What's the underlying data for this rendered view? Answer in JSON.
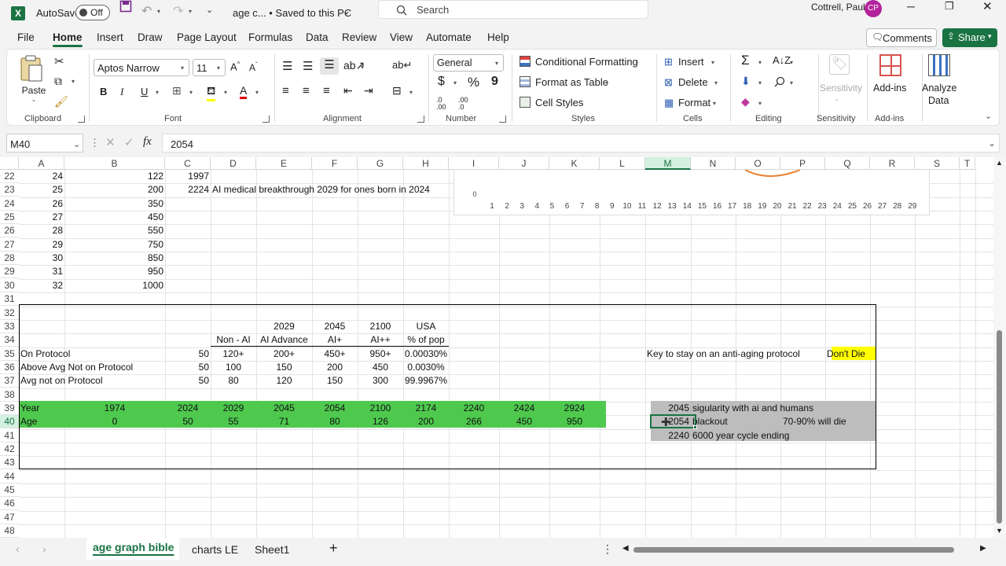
{
  "titlebar": {
    "autosave_label": "AutoSave",
    "autosave_state": "Off",
    "doc_title": "age c... • Saved to this PC",
    "search_placeholder": "Search",
    "user_name": "Cottrell, Paul",
    "user_initials": "CP"
  },
  "menu": {
    "items": [
      "File",
      "Home",
      "Insert",
      "Draw",
      "Page Layout",
      "Formulas",
      "Data",
      "Review",
      "View",
      "Automate",
      "Help"
    ],
    "active": "Home",
    "comments_label": "Comments",
    "share_label": "Share"
  },
  "ribbon": {
    "clipboard": {
      "paste": "Paste",
      "label": "Clipboard"
    },
    "font": {
      "name": "Aptos Narrow",
      "size": "11",
      "label": "Font",
      "bold": "B",
      "italic": "I",
      "underline": "U"
    },
    "alignment": {
      "label": "Alignment"
    },
    "number": {
      "format": "General",
      "label": "Number",
      "currency": "$",
      "percent": "%",
      "comma": "9",
      "inc": ".0 .00",
      "dec": ".00 .0"
    },
    "styles": {
      "conditional": "Conditional Formatting",
      "table": "Format as Table",
      "cell_styles": "Cell Styles",
      "label": "Styles"
    },
    "cells": {
      "insert": "Insert",
      "delete": "Delete",
      "format": "Format",
      "label": "Cells"
    },
    "editing": {
      "label": "Editing"
    },
    "sensitivity": {
      "button": "Sensitivity",
      "label": "Sensitivity"
    },
    "addins": {
      "button": "Add-ins",
      "label": "Add-ins"
    },
    "analyze": {
      "button1": "Analyze",
      "button2": "Data"
    }
  },
  "formula_bar": {
    "name_box": "M40",
    "fx": "fx",
    "value": "2054"
  },
  "grid": {
    "columns": [
      "A",
      "B",
      "C",
      "D",
      "E",
      "F",
      "G",
      "H",
      "I",
      "J",
      "K",
      "L",
      "M",
      "N",
      "O",
      "P",
      "Q",
      "R",
      "S",
      "T"
    ],
    "rows": [
      "22",
      "23",
      "24",
      "25",
      "26",
      "27",
      "28",
      "29",
      "30",
      "31",
      "32",
      "33",
      "34",
      "35",
      "36",
      "37",
      "38",
      "39",
      "40",
      "41",
      "42",
      "43",
      "44",
      "45",
      "46",
      "47",
      "48"
    ],
    "selected_column": "M",
    "selected_row": "40",
    "cells": {
      "A22": "24",
      "B22": "122",
      "C22": "1997",
      "A23": "25",
      "B23": "200",
      "C23": "2224",
      "D23": "AI medical breakthrough 2029 for ones born in 2024",
      "A24": "26",
      "B24": "350",
      "A25": "27",
      "B25": "450",
      "A26": "28",
      "B26": "550",
      "A27": "29",
      "B27": "750",
      "A28": "30",
      "B28": "850",
      "A29": "31",
      "B29": "950",
      "A30": "32",
      "B30": "1000",
      "E33": "2029",
      "F33": "2045",
      "G33": "2100",
      "H33": "USA",
      "D34": "Non - AI",
      "E34": "AI Advance",
      "F34": "AI+",
      "G34": "AI++",
      "H34": "% of pop",
      "A35": "On Protocol",
      "C35": "50",
      "D35": "120+",
      "E35": "200+",
      "F35": "450+",
      "G35": "950+",
      "H35": "0.00030%",
      "M35": "Key to stay on an anti-aging protocol",
      "Q35": "Don't Die",
      "A36": "Above Avg Not on Protocol",
      "C36": "50",
      "D36": "100",
      "E36": "150",
      "F36": "200",
      "G36": "450",
      "H36": "0.0030%",
      "A37": "Avg not on  Protocol",
      "C37": "50",
      "D37": "80",
      "E37": "120",
      "F37": "150",
      "G37": "300",
      "H37": "99.9967%",
      "A39": "Year",
      "B39": "1974",
      "C39": "2024",
      "D39": "2029",
      "E39": "2045",
      "F39": "2054",
      "G39": "2100",
      "H39": "2174",
      "I39": "2240",
      "J39": "2424",
      "K39": "2924",
      "M39": "2045",
      "N39": "sigularity with ai and humans",
      "A40": "Age",
      "B40": "0",
      "C40": "50",
      "D40": "55",
      "E40": "71",
      "F40": "80",
      "G40": "126",
      "H40": "200",
      "I40": "266",
      "J40": "450",
      "K40": "950",
      "M40": "2054",
      "N40": "blackout",
      "O40": "70-90% will die",
      "M41": "2240",
      "N41": "6000 year cycle ending"
    }
  },
  "chart_data": {
    "type": "line",
    "x": [
      "1",
      "2",
      "3",
      "4",
      "5",
      "6",
      "7",
      "8",
      "9",
      "10",
      "11",
      "12",
      "13",
      "14",
      "15",
      "16",
      "17",
      "18",
      "19",
      "20",
      "21",
      "22",
      "23",
      "24",
      "25",
      "26",
      "27",
      "28",
      "29"
    ],
    "y_tick": "0",
    "series_color": "#e8802f"
  },
  "sheets": {
    "tabs": [
      "age graph bible",
      "charts LE",
      "Sheet1"
    ],
    "active": "age graph bible",
    "add": "+"
  },
  "colors": {
    "excel_green": "#1a7343",
    "row_green": "#4ec94e",
    "gray_block": "#bdbdbd",
    "yellow": "#ffff00"
  }
}
